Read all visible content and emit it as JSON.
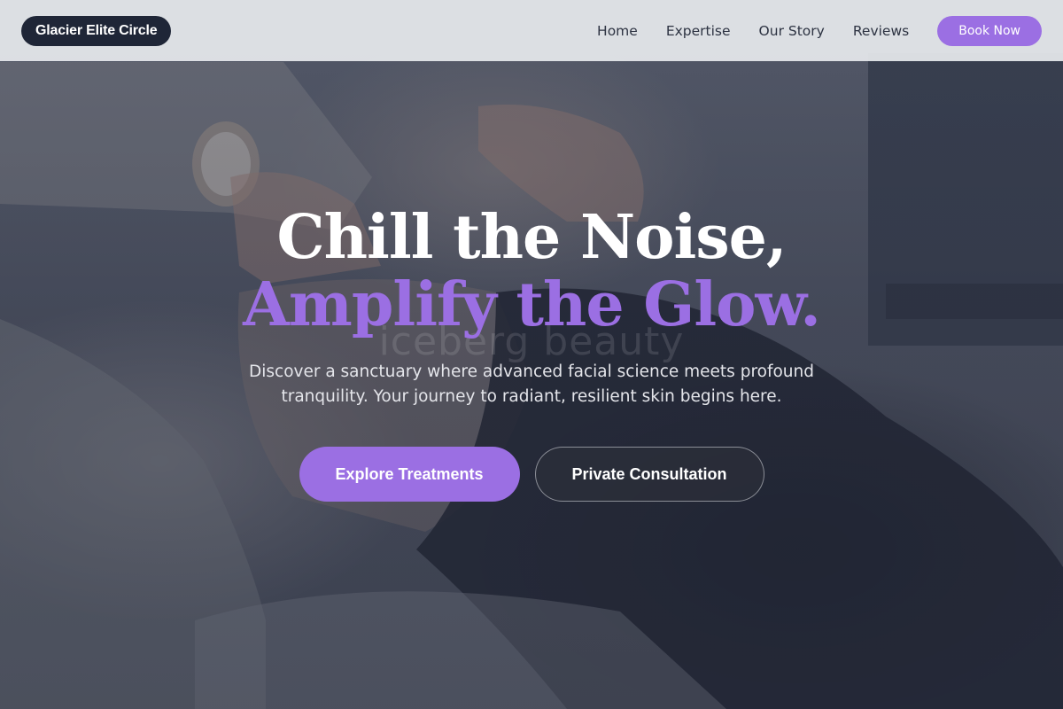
{
  "header": {
    "brand": "Glacier Elite Circle",
    "nav": [
      {
        "label": "Home"
      },
      {
        "label": "Expertise"
      },
      {
        "label": "Our Story"
      },
      {
        "label": "Reviews"
      }
    ],
    "cta_label": "Book Now"
  },
  "hero": {
    "headline_line1": "Chill the Noise,",
    "headline_line2": "Amplify the Glow.",
    "watermark": "iceberg beauty",
    "subtitle": "Discover a sanctuary where advanced facial science meets profound tranquility. Your journey to radiant, resilient skin begins here.",
    "primary_cta": "Explore Treatments",
    "secondary_cta": "Private Consultation"
  },
  "colors": {
    "accent": "#9b6fe3",
    "brand_pill": "#1f2637",
    "header_bg": "#e8eaee",
    "overlay": "#232837"
  }
}
